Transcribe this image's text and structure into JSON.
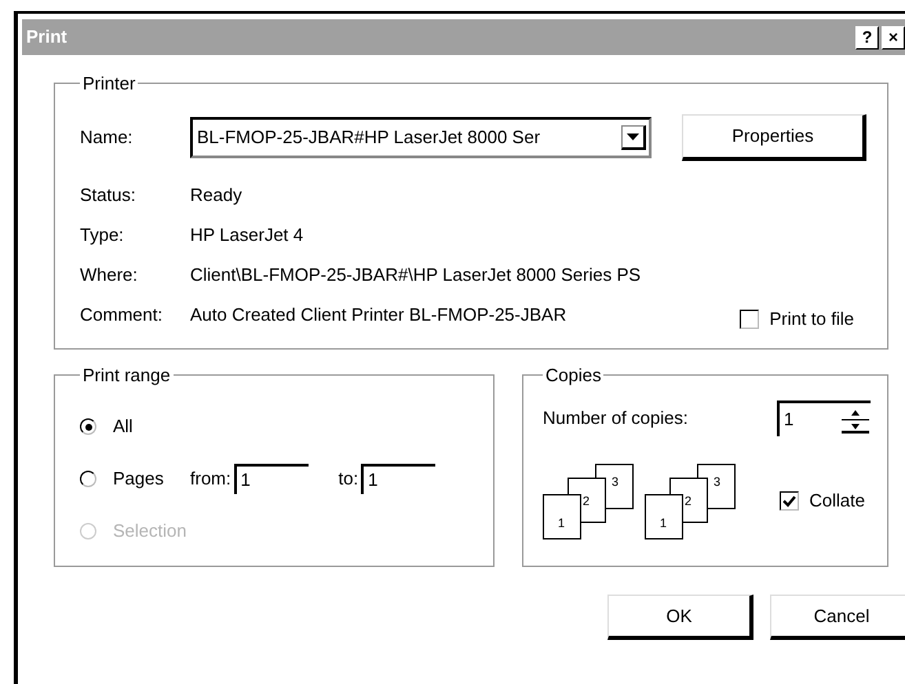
{
  "window": {
    "title": "Print",
    "buttons": [
      "?",
      "×"
    ]
  },
  "printer": {
    "group": "Printer",
    "name_label": "Name:",
    "name_value": "BL-FMOP-25-JBAR#HP LaserJet 8000 Ser",
    "properties": "Properties",
    "details": [
      {
        "label": "Status:",
        "value": "Ready"
      },
      {
        "label": "Type:",
        "value": "HP LaserJet 4"
      },
      {
        "label": "Where:",
        "value": "Client\\BL-FMOP-25-JBAR#\\HP LaserJet 8000 Series PS"
      },
      {
        "label": "Comment:",
        "value": "Auto Created Client Printer BL-FMOP-25-JBAR"
      }
    ],
    "print_to_file": {
      "label": "Print to file",
      "checked": false
    }
  },
  "print_range": {
    "group": "Print range",
    "options": [
      {
        "label": "All",
        "selected": true,
        "disabled": false
      },
      {
        "label": "Pages",
        "selected": false,
        "disabled": false,
        "from": {
          "label": "from:",
          "value": "1"
        },
        "to": {
          "label": "to:",
          "value": "1"
        }
      },
      {
        "label": "Selection",
        "selected": false,
        "disabled": true
      }
    ]
  },
  "copies": {
    "group": "Copies",
    "number_label": "Number of copies:",
    "number_value": "1",
    "collate_drawings": [
      {
        "page_numbers": [
          "1",
          "2",
          "3"
        ]
      },
      {
        "page_numbers": [
          "1",
          "2",
          "3"
        ]
      }
    ],
    "collate": {
      "label": "Collate",
      "checked": true
    }
  },
  "buttons": [
    "OK",
    "Cancel"
  ]
}
